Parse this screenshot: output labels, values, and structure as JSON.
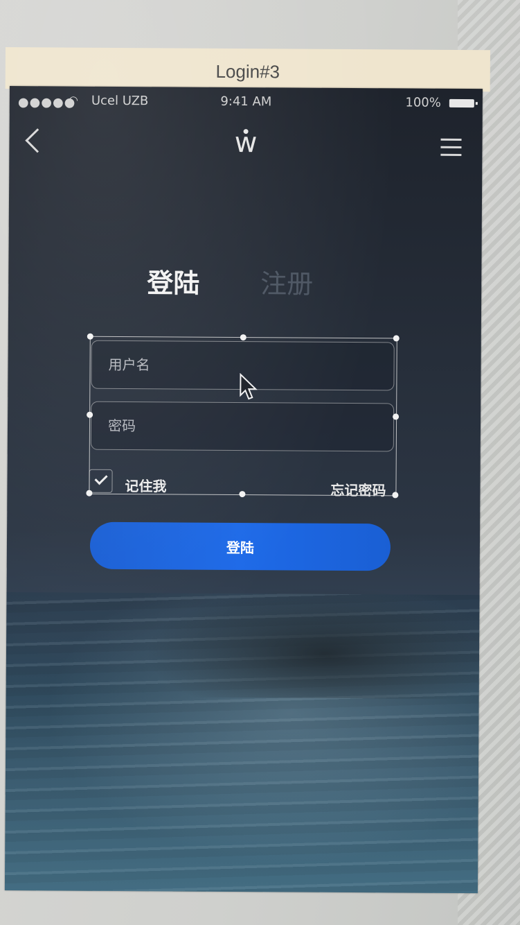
{
  "artboard": {
    "title": "Login#3"
  },
  "status_bar": {
    "signal": "●●●●●",
    "carrier": "Ucel UZB",
    "time": "9:41 AM",
    "battery": "100%"
  },
  "nav": {
    "logo": "w",
    "back_icon": "chevron-left-icon",
    "menu_icon": "hamburger-menu-icon"
  },
  "tabs": [
    {
      "label": "登陆",
      "active": true
    },
    {
      "label": "注册",
      "active": false
    }
  ],
  "form": {
    "username_placeholder": "用户名",
    "password_placeholder": "密码",
    "remember_label": "记住我",
    "remember_checked": true,
    "forgot_label": "忘记密码",
    "submit_label": "登陆"
  },
  "colors": {
    "primary_button": "#1a5fd4",
    "background_top": "#1e232c",
    "inactive_tab": "#4b5461"
  }
}
